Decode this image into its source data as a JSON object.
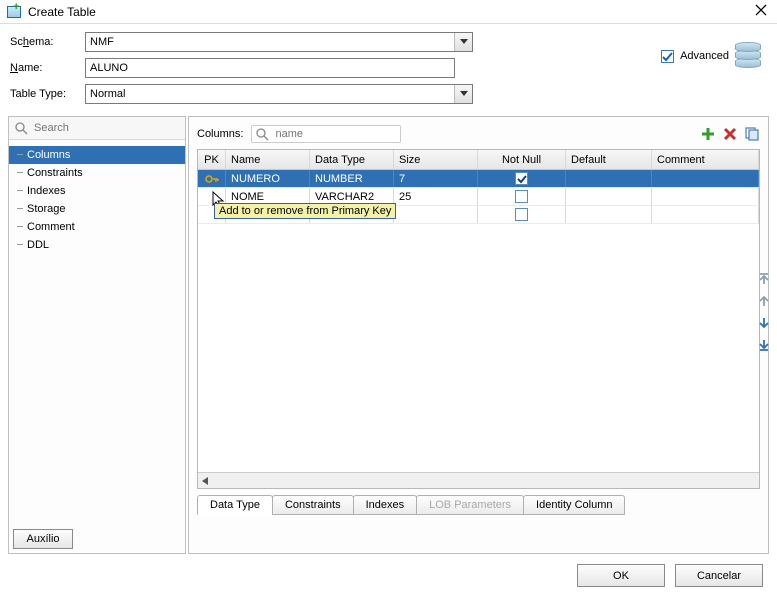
{
  "window": {
    "title": "Create Table"
  },
  "form": {
    "schema_label_pre": "Sc",
    "schema_label_ul": "h",
    "schema_label_post": "ema:",
    "schema_value": "NMF",
    "name_label_ul": "N",
    "name_label_post": "ame:",
    "name_value": "ALUNO",
    "tabletype_label": "Table Type:",
    "tabletype_value": "Normal",
    "advanced_label": "Advanced",
    "advanced_checked": true
  },
  "tree_search_placeholder": "Search",
  "tree_items": [
    {
      "label": "Columns",
      "selected": true
    },
    {
      "label": "Constraints",
      "selected": false
    },
    {
      "label": "Indexes",
      "selected": false
    },
    {
      "label": "Storage",
      "selected": false
    },
    {
      "label": "Comment",
      "selected": false
    },
    {
      "label": "DDL",
      "selected": false
    }
  ],
  "columns_panel": {
    "header_label": "Columns:",
    "search_placeholder": "name",
    "toolbar_icons": [
      "add",
      "delete",
      "copy"
    ],
    "grid_headers": {
      "pk": "PK",
      "name": "Name",
      "type": "Data Type",
      "size": "Size",
      "notnull": "Not Null",
      "default": "Default",
      "comment": "Comment"
    },
    "rows": [
      {
        "pk": true,
        "name": "NUMERO",
        "type": "NUMBER",
        "size": "7",
        "notnull": true,
        "default": "",
        "comment": "",
        "selected": true
      },
      {
        "pk": false,
        "name": "NOME",
        "type": "VARCHAR2",
        "size": "25",
        "notnull": false,
        "default": "",
        "comment": "",
        "selected": false
      },
      {
        "pk": false,
        "name": "",
        "type": "",
        "size": "",
        "notnull": false,
        "default": "",
        "comment": "",
        "selected": false
      }
    ],
    "tooltip": "Add to or remove from Primary Key"
  },
  "subtabs": [
    {
      "label": "Data Type",
      "active": true,
      "disabled": false
    },
    {
      "label": "Constraints",
      "active": false,
      "disabled": false
    },
    {
      "label": "Indexes",
      "active": false,
      "disabled": false
    },
    {
      "label": "LOB Parameters",
      "active": false,
      "disabled": true
    },
    {
      "label": "Identity Column",
      "active": false,
      "disabled": false
    }
  ],
  "buttons": {
    "help": "Auxílio",
    "ok": "OK",
    "cancel": "Cancelar"
  }
}
